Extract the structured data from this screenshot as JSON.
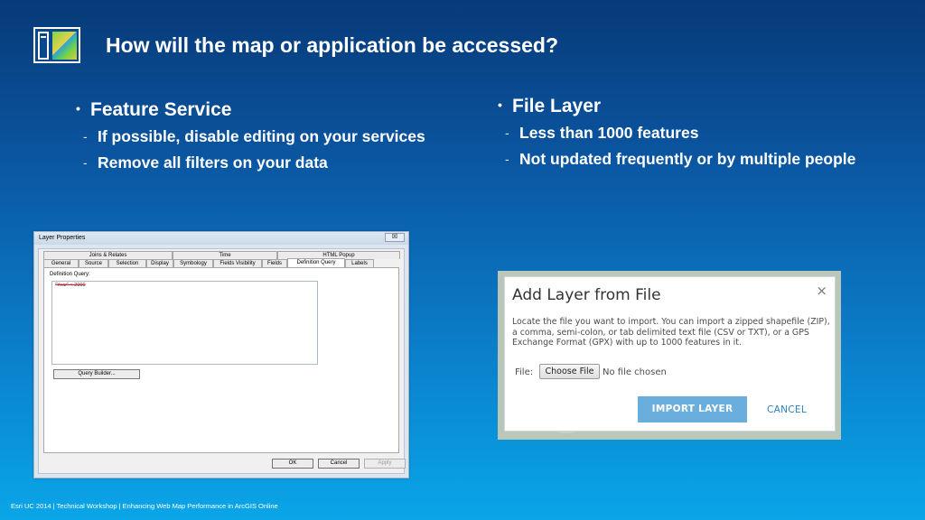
{
  "slide": {
    "title": "How will the map or application be accessed?",
    "footer": "Esri UC 2014 | Technical Workshop |  Enhancing Web Map Performance in ArcGIS Online"
  },
  "left_bullets": {
    "main": "Feature Service",
    "subs": [
      "If possible, disable editing on your services",
      "Remove all filters on your data"
    ]
  },
  "right_bullets": {
    "main": "File Layer",
    "subs": [
      "Less than 1000 features",
      "Not updated frequently or by multiple people"
    ]
  },
  "layer_properties": {
    "title": "Layer Properties",
    "close": "☒",
    "tabs_row1": [
      "Joins & Relates",
      "Time",
      "HTML Popup"
    ],
    "tabs_row2": [
      "General",
      "Source",
      "Selection",
      "Display",
      "Symbology",
      "Fields Visibility",
      "Fields",
      "Definition Query",
      "Labels"
    ],
    "active_tab": "Definition Query",
    "definition_query_label": "Definition Query:",
    "definition_query_value": "\"Year\" < 2000",
    "query_builder": "Query Builder...",
    "ok": "OK",
    "cancel": "Cancel",
    "apply": "Apply"
  },
  "add_layer_from_file": {
    "title": "Add Layer from File",
    "close": "×",
    "description": "Locate the file you want to import. You can import a zipped shapefile (ZIP), a comma, semi-colon, or tab delimited text file (CSV or TXT), or a GPS Exchange Format (GPX) with up to 1000 features in it.",
    "file_label": "File:",
    "choose_file": "Choose File",
    "no_file": "No file chosen",
    "import": "IMPORT LAYER",
    "cancel": "CANCEL"
  }
}
